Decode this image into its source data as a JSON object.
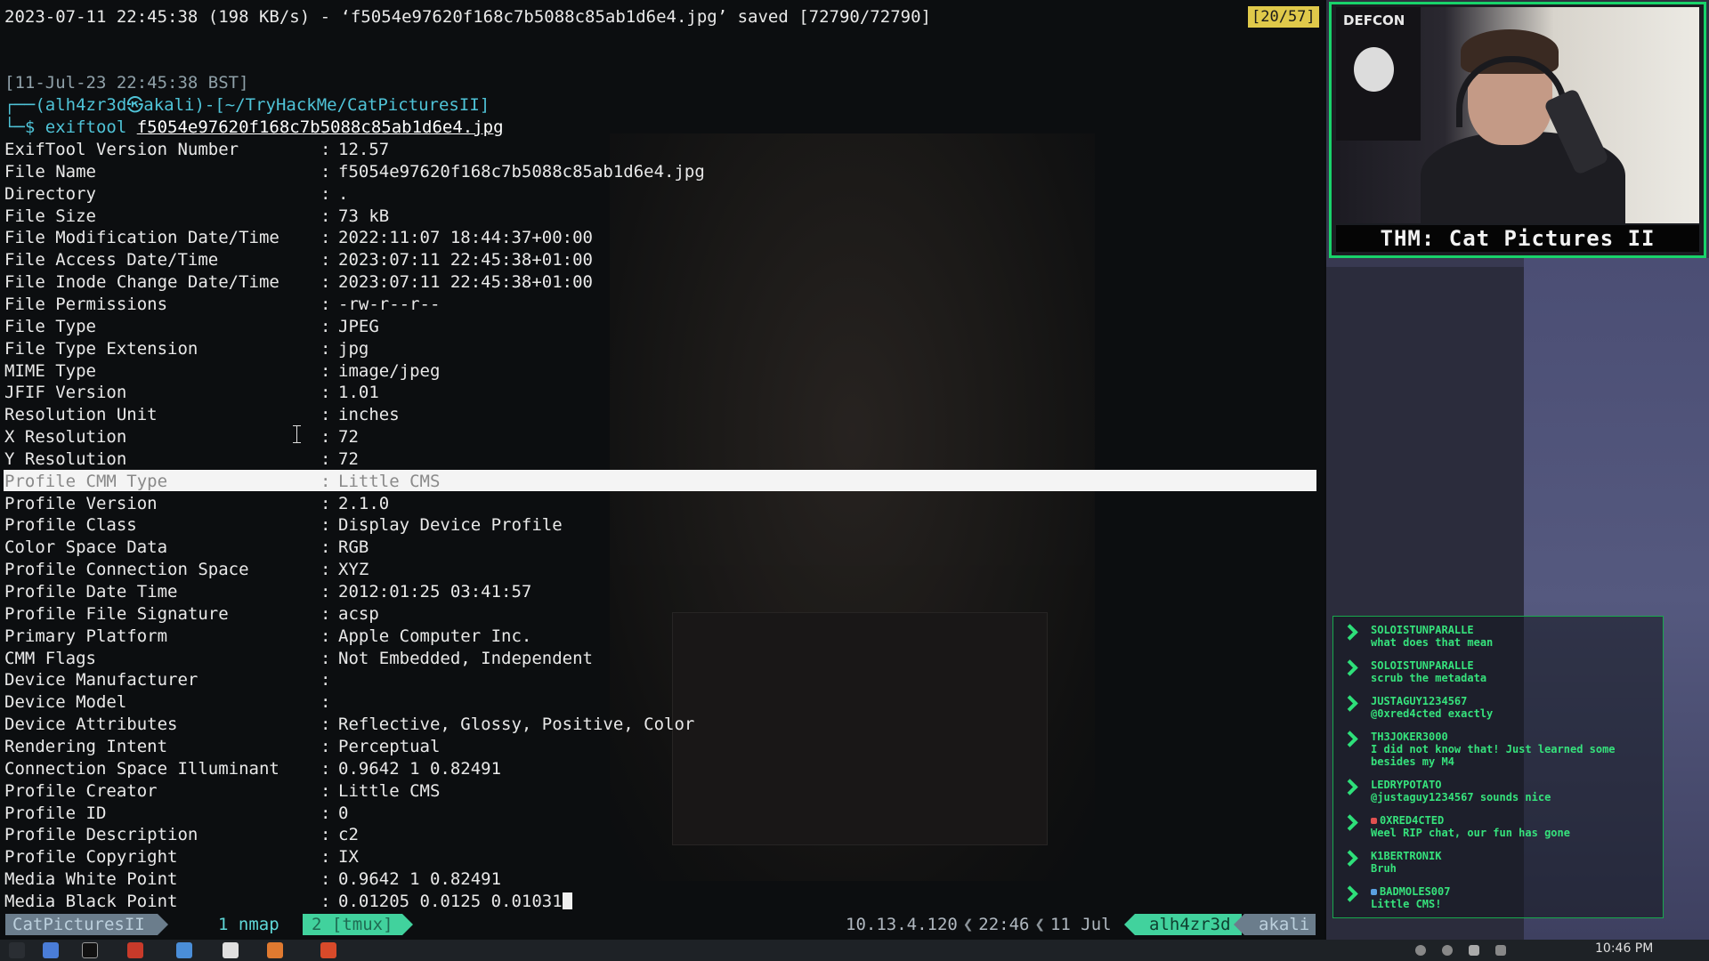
{
  "terminal": {
    "top_line": "2023-07-11 22:45:38 (198 KB/s) - ‘f5054e97620f168c7b5088c85ab1d6e4.jpg’ saved [72790/72790]",
    "counter": "[20/57]",
    "date_line": "[11-Jul-23 22:45:38 BST]",
    "prompt": "┌──(alh4zr3d㉿akali)-[~/TryHackMe/CatPicturesII]",
    "cmd_prefix": "└─$ exiftool ",
    "cmd_file": "f5054e97620f168c7b5088c85ab1d6e4.jpg",
    "rows": [
      {
        "key": "ExifTool Version Number",
        "value": "12.57"
      },
      {
        "key": "File Name",
        "value": "f5054e97620f168c7b5088c85ab1d6e4.jpg"
      },
      {
        "key": "Directory",
        "value": "."
      },
      {
        "key": "File Size",
        "value": "73 kB"
      },
      {
        "key": "File Modification Date/Time",
        "value": "2022:11:07 18:44:37+00:00"
      },
      {
        "key": "File Access Date/Time",
        "value": "2023:07:11 22:45:38+01:00"
      },
      {
        "key": "File Inode Change Date/Time",
        "value": "2023:07:11 22:45:38+01:00"
      },
      {
        "key": "File Permissions",
        "value": "-rw-r--r--"
      },
      {
        "key": "File Type",
        "value": "JPEG"
      },
      {
        "key": "File Type Extension",
        "value": "jpg"
      },
      {
        "key": "MIME Type",
        "value": "image/jpeg"
      },
      {
        "key": "JFIF Version",
        "value": "1.01"
      },
      {
        "key": "Resolution Unit",
        "value": "inches"
      },
      {
        "key": "X Resolution",
        "value": "72"
      },
      {
        "key": "Y Resolution",
        "value": "72"
      },
      {
        "key": "Profile CMM Type",
        "value": "Little CMS"
      },
      {
        "key": "Profile Version",
        "value": "2.1.0"
      },
      {
        "key": "Profile Class",
        "value": "Display Device Profile"
      },
      {
        "key": "Color Space Data",
        "value": "RGB"
      },
      {
        "key": "Profile Connection Space",
        "value": "XYZ"
      },
      {
        "key": "Profile Date Time",
        "value": "2012:01:25 03:41:57"
      },
      {
        "key": "Profile File Signature",
        "value": "acsp"
      },
      {
        "key": "Primary Platform",
        "value": "Apple Computer Inc."
      },
      {
        "key": "CMM Flags",
        "value": "Not Embedded, Independent"
      },
      {
        "key": "Device Manufacturer",
        "value": ""
      },
      {
        "key": "Device Model",
        "value": ""
      },
      {
        "key": "Device Attributes",
        "value": "Reflective, Glossy, Positive, Color"
      },
      {
        "key": "Rendering Intent",
        "value": "Perceptual"
      },
      {
        "key": "Connection Space Illuminant",
        "value": "0.9642 1 0.82491"
      },
      {
        "key": "Profile Creator",
        "value": "Little CMS"
      },
      {
        "key": "Profile ID",
        "value": "0"
      },
      {
        "key": "Profile Description",
        "value": "c2"
      },
      {
        "key": "Profile Copyright",
        "value": "IX"
      },
      {
        "key": "Media White Point",
        "value": "0.9642 1 0.82491"
      },
      {
        "key": "Media Black Point",
        "value": "0.01205 0.0125 0.01031"
      }
    ],
    "highlighted_row": "Profile CMM Type"
  },
  "statusbar": {
    "session": "CatPicturesII",
    "window1": "1 nmap",
    "window2": "2 [tmux]",
    "ip": "10.13.4.120",
    "time": "22:46",
    "date": "11 Jul",
    "user": "alh4zr3d",
    "host": "akali"
  },
  "webcam": {
    "flag_text": "DEFCON",
    "title": "THM: Cat Pictures II"
  },
  "chat": [
    {
      "user": "SOLOISTUNPARALLE",
      "text": "what does that mean"
    },
    {
      "user": "SOLOISTUNPARALLE",
      "text": "scrub the metadata"
    },
    {
      "user": "JUSTAGUY1234567",
      "text": "@0xred4cted exactly"
    },
    {
      "user": "TH3JOKER3000",
      "text": "I did not know that! Just learned some besides my M4"
    },
    {
      "user": "LEDRYPOTATO",
      "text": "@justaguy1234567 sounds nice"
    },
    {
      "user": "0XRED4CTED",
      "text": "Weel RIP chat, our fun has gone"
    },
    {
      "user": "K1BERTRONIK",
      "text": "Bruh"
    },
    {
      "user": "BADMOLES007",
      "text": "Little CMS!"
    }
  ],
  "taskbar": {
    "clock": "10:46 PM"
  },
  "colors": {
    "accent_green": "#18d36a",
    "tmux_green": "#41d29d",
    "counter_yellow": "#e0c94a",
    "prompt_cyan": "#4fc3d7"
  }
}
